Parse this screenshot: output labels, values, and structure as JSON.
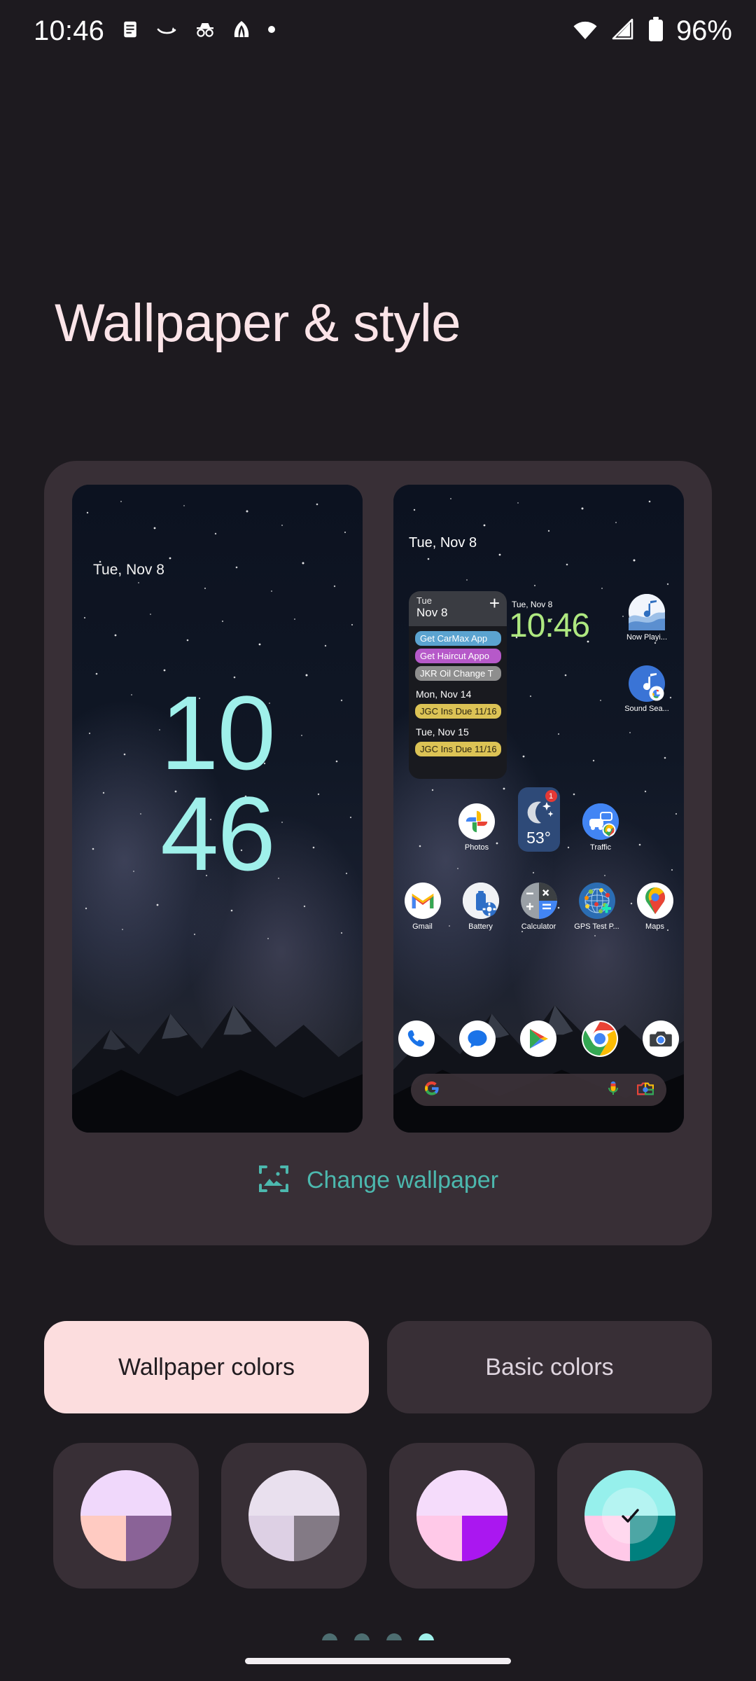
{
  "status_bar": {
    "clock": "10:46",
    "battery_percent": "96%",
    "left_icons": [
      "notes-icon",
      "amazon-icon",
      "incognito-icon",
      "app-icon",
      "dot-icon"
    ],
    "right_icons": [
      "wifi-icon",
      "cellular-signal-icon",
      "battery-icon"
    ]
  },
  "header": {
    "title": "Wallpaper & style"
  },
  "preview": {
    "lock_screen": {
      "name": "lock-screen-preview",
      "date": "Tue, Nov 8",
      "clock_hours": "10",
      "clock_minutes": "46",
      "clock_color": "#9ff0ea"
    },
    "home_screen": {
      "name": "home-screen-preview",
      "status_date": "Tue, Nov 8",
      "clock_widget": {
        "date": "Tue, Nov 8",
        "time": "10:46",
        "color": "#aee880"
      },
      "calendar_widget": {
        "header_day": "Tue",
        "header_date": "Nov 8",
        "add_label": "+",
        "events": [
          {
            "label": "Get CarMax App",
            "color": "#5ba3d0"
          },
          {
            "label": "Get Haircut Appo",
            "color": "#b659c9"
          },
          {
            "label": "JKR Oil Change T",
            "color": "#8e8e8e"
          }
        ],
        "sections": [
          {
            "day": "Mon, Nov 14",
            "events": [
              {
                "label": "JGC Ins Due 11/16",
                "color": "#dcc355"
              }
            ]
          },
          {
            "day": "Tue, Nov 15",
            "events": [
              {
                "label": "JGC Ins Due 11/16",
                "color": "#dcc355"
              }
            ]
          }
        ]
      },
      "side_apps": [
        {
          "label": "Now Playi...",
          "icon": "now-playing-icon"
        },
        {
          "label": "Sound Sea...",
          "icon": "sound-search-icon"
        }
      ],
      "row_weather": [
        {
          "label": "Photos",
          "icon": "google-photos-icon"
        },
        {
          "label": "",
          "icon": "weather-widget-icon",
          "temp": "53°",
          "badge": "1"
        },
        {
          "label": "Traffic",
          "icon": "traffic-icon"
        }
      ],
      "row_apps": [
        {
          "label": "Gmail",
          "icon": "gmail-icon"
        },
        {
          "label": "Battery",
          "icon": "battery-app-icon"
        },
        {
          "label": "Calculator",
          "icon": "calculator-icon"
        },
        {
          "label": "GPS Test P...",
          "icon": "gps-test-icon"
        },
        {
          "label": "Maps",
          "icon": "google-maps-icon"
        }
      ],
      "dock": [
        {
          "icon": "phone-icon"
        },
        {
          "icon": "messages-icon"
        },
        {
          "icon": "play-store-icon"
        },
        {
          "icon": "chrome-icon"
        },
        {
          "icon": "camera-icon"
        }
      ],
      "search_bar": {
        "leading_icon": "google-g-icon",
        "mic_icon": "microphone-icon",
        "lens_icon": "google-lens-icon"
      }
    }
  },
  "change_wallpaper": {
    "label": "Change wallpaper",
    "icon": "image-crop-icon",
    "color": "#4cb8ae"
  },
  "color_tabs": [
    {
      "label": "Wallpaper colors",
      "selected": true
    },
    {
      "label": "Basic colors",
      "selected": false
    }
  ],
  "color_swatches": [
    {
      "name": "swatch-1",
      "top": "#f0d8fb",
      "bottom_left": "#ffcbc2",
      "bottom_right": "#8a6397",
      "selected": false
    },
    {
      "name": "swatch-2",
      "top": "#e9e0ee",
      "bottom_left": "#ddd0e4",
      "bottom_right": "#837a85",
      "selected": false
    },
    {
      "name": "swatch-3",
      "top": "#f5dcfb",
      "bottom_left": "#ffc9e8",
      "bottom_right": "#aa17f0",
      "selected": false
    },
    {
      "name": "swatch-4",
      "top": "#96f0ec",
      "bottom_left": "#ffc9e8",
      "bottom_right": "#00807e",
      "selected": true
    }
  ],
  "page_dots": {
    "count": 4,
    "active_index": 3
  }
}
